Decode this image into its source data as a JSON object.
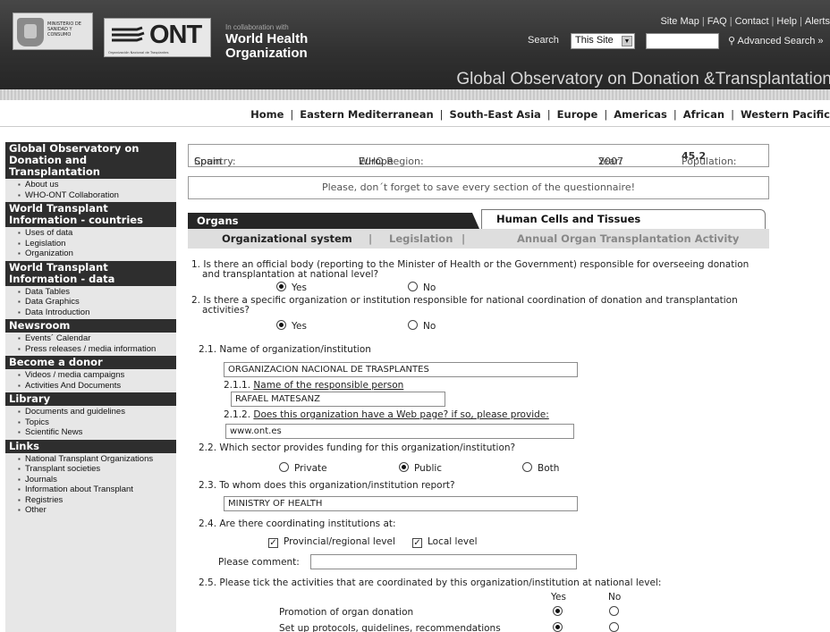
{
  "header": {
    "ministerio_text": "Ministerio de Sanidad y Consumo",
    "ont_logo": "ONT",
    "ont_sub": "Organización Nacional de Trasplantes",
    "collab_small": "In collaboration with",
    "collab_line1": "World Health",
    "collab_line2": "Organization",
    "top_links": [
      "Site Map",
      "FAQ",
      "Contact",
      "Help",
      "Alerts"
    ],
    "search_label": "Search",
    "search_scope": "This Site",
    "search_value": "",
    "advanced_search": "Advanced Search »",
    "site_title": "Global Observatory on Donation &Transplantation"
  },
  "nav": {
    "items": [
      "Home",
      "Eastern Mediterranean",
      "South-East Asia",
      "Europe",
      "Americas",
      "African",
      "Western Pacific"
    ]
  },
  "sidebar": {
    "sections": [
      {
        "title": "Global Observatory on Donation and Transplantation",
        "items": [
          "About us",
          "WHO-ONT Collaboration"
        ]
      },
      {
        "title": "World Transplant Information - countries",
        "items": [
          "Uses of data",
          "Legislation",
          "Organization"
        ]
      },
      {
        "title": "World Transplant Information - data",
        "items": [
          "Data Tables",
          "Data Graphics",
          "Data Introduction"
        ]
      },
      {
        "title": "Newsroom",
        "items": [
          "Events´ Calendar",
          "Press releases / media information"
        ]
      },
      {
        "title": "Become a donor",
        "items": [
          "Videos / media campaigns",
          "Activities And Documents"
        ]
      },
      {
        "title": "Library",
        "items": [
          "Documents and guidelines",
          "Topics",
          "Scientific News"
        ]
      },
      {
        "title": "Links",
        "items": [
          "National Transplant Organizations",
          "Transplant societies",
          "Journals",
          "Information about Transplant",
          "Registries",
          "Other"
        ]
      }
    ]
  },
  "info": {
    "country_label": "Country:",
    "country": "Spain",
    "region_label": "WHO Region:",
    "region": "Europe",
    "year_label": "Year:",
    "year": "2007",
    "population_label": "Population:",
    "population": "45.2",
    "notice": "Please, don´t forget to save every section of the questionnaire!"
  },
  "tabs": {
    "organs": "Organs",
    "cells": "Human Cells and Tissues",
    "sub": [
      "Organizational system",
      "Legislation",
      "Annual Organ Transplantation Activity"
    ]
  },
  "form": {
    "q1": "1. Is there an official body (reporting to the Minister of Health or the Government) responsible for overseeing donation",
    "q1b": "and transplantation at national level?",
    "q2": "2. Is there a specific organization or institution responsible for national coordination of donation and transplantation",
    "q2b": "activities?",
    "yes": "Yes",
    "no": "No",
    "q21": "2.1. Name of organization/institution",
    "q21_value": "ORGANIZACION NACIONAL DE TRASPLANTES",
    "q211_num": "2.1.1.",
    "q211": "Name of the responsible person",
    "q211_value": "RAFAEL MATESANZ",
    "q212_num": "2.1.2.",
    "q212": "Does this organization have a Web page? if so, please provide:",
    "q212_value": "www.ont.es",
    "q22": "2.2. Which sector provides funding for this organization/institution?",
    "private": "Private",
    "public": "Public",
    "both": "Both",
    "q23": "2.3. To whom does this organization/institution report?",
    "q23_value": "MINISTRY OF HEALTH",
    "q24": "2.4. Are there coordinating institutions at:",
    "provincial": "Provincial/regional level",
    "local": "Local level",
    "comment_label": "Please comment:",
    "comment_value": "",
    "q25": "2.5. Please tick the activities that are coordinated by this organization/institution at national level:",
    "col_yes": "Yes",
    "col_no": "No",
    "act1": "Promotion of organ donation",
    "act2": "Set up protocols, guidelines, recommendations"
  }
}
